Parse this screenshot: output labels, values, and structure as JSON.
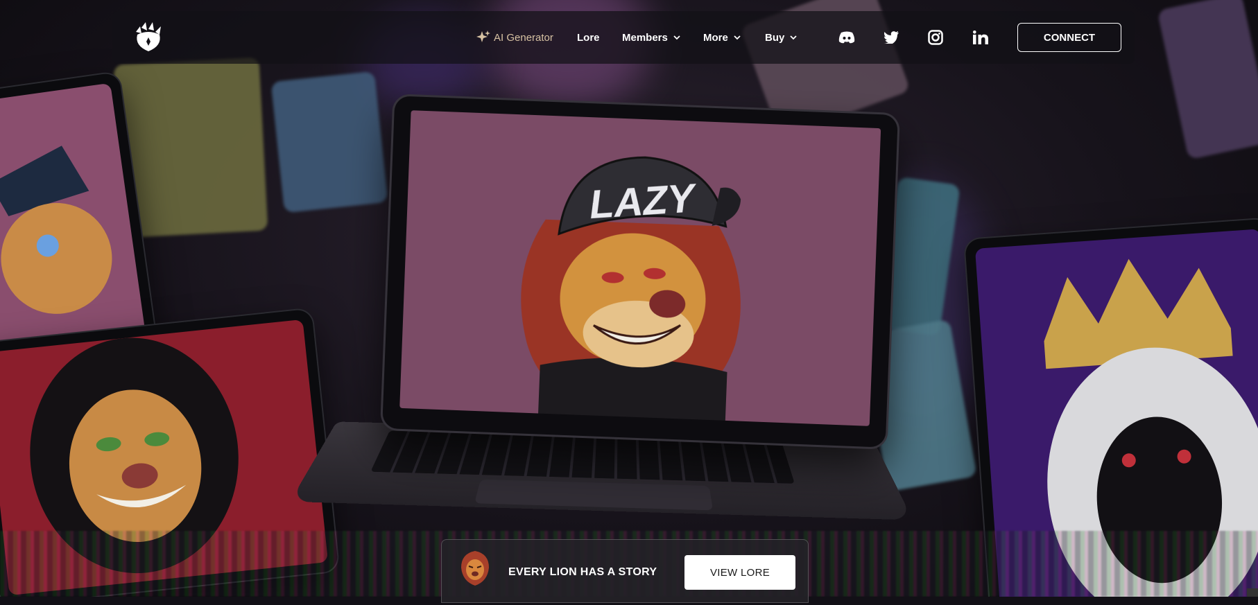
{
  "nav": {
    "ai_generator": "AI Generator",
    "lore": "Lore",
    "members": "Members",
    "more": "More",
    "buy": "Buy",
    "connect": "CONNECT"
  },
  "social": [
    "discord-icon",
    "twitter-icon",
    "instagram-icon",
    "linkedin-icon"
  ],
  "hero": {
    "cap_text": "LAZY"
  },
  "banner": {
    "text": "EVERY LION HAS A STORY",
    "button": "VIEW LORE"
  },
  "colors": {
    "accent_ai": "#d7c2a3",
    "nav_bg": "#121016",
    "laptop_screen": "#7b4b66"
  }
}
